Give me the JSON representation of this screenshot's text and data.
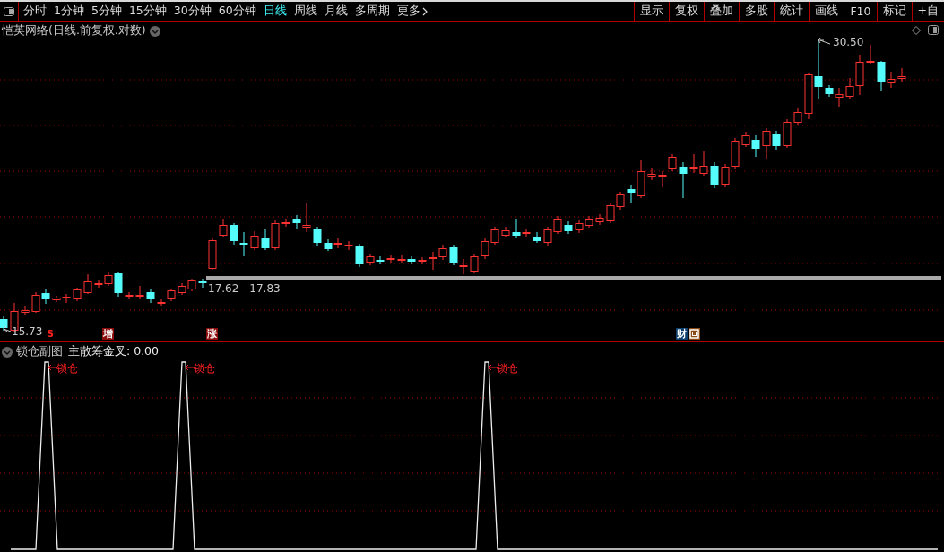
{
  "toolbar": {
    "periods": [
      {
        "label": "分时",
        "selected": false
      },
      {
        "label": "1分钟",
        "selected": false
      },
      {
        "label": "5分钟",
        "selected": false
      },
      {
        "label": "15分钟",
        "selected": false
      },
      {
        "label": "30分钟",
        "selected": false
      },
      {
        "label": "60分钟",
        "selected": false
      },
      {
        "label": "日线",
        "selected": true
      },
      {
        "label": "周线",
        "selected": false
      },
      {
        "label": "月线",
        "selected": false
      },
      {
        "label": "多周期",
        "selected": false
      },
      {
        "label": "更多",
        "selected": false
      }
    ],
    "tools": [
      "显示",
      "复权",
      "叠加",
      "多股",
      "统计",
      "画线",
      "F10",
      "标记",
      "+自"
    ]
  },
  "chart": {
    "title": "恺英网络(日线.前复权.对数)",
    "high_label": "30.50",
    "low_label": "15.73",
    "range_label": "17.62 - 17.83",
    "markers": [
      {
        "label": "S",
        "kind": "plain",
        "color": "#ff2020"
      },
      {
        "label": "增",
        "kind": "badge",
        "color": "#8a0c0c"
      },
      {
        "label": "涨",
        "kind": "badge",
        "color": "#8a0c0c"
      },
      {
        "label": "财",
        "kind": "badge",
        "color": "#0c3f6e"
      },
      {
        "kind": "icon",
        "color": "#8a4a12"
      }
    ]
  },
  "sub_chart": {
    "title": "锁仓副图",
    "indicator": "主散筹金叉: 0.00",
    "signals": [
      "锁仓",
      "锁仓",
      "锁仓"
    ]
  }
}
